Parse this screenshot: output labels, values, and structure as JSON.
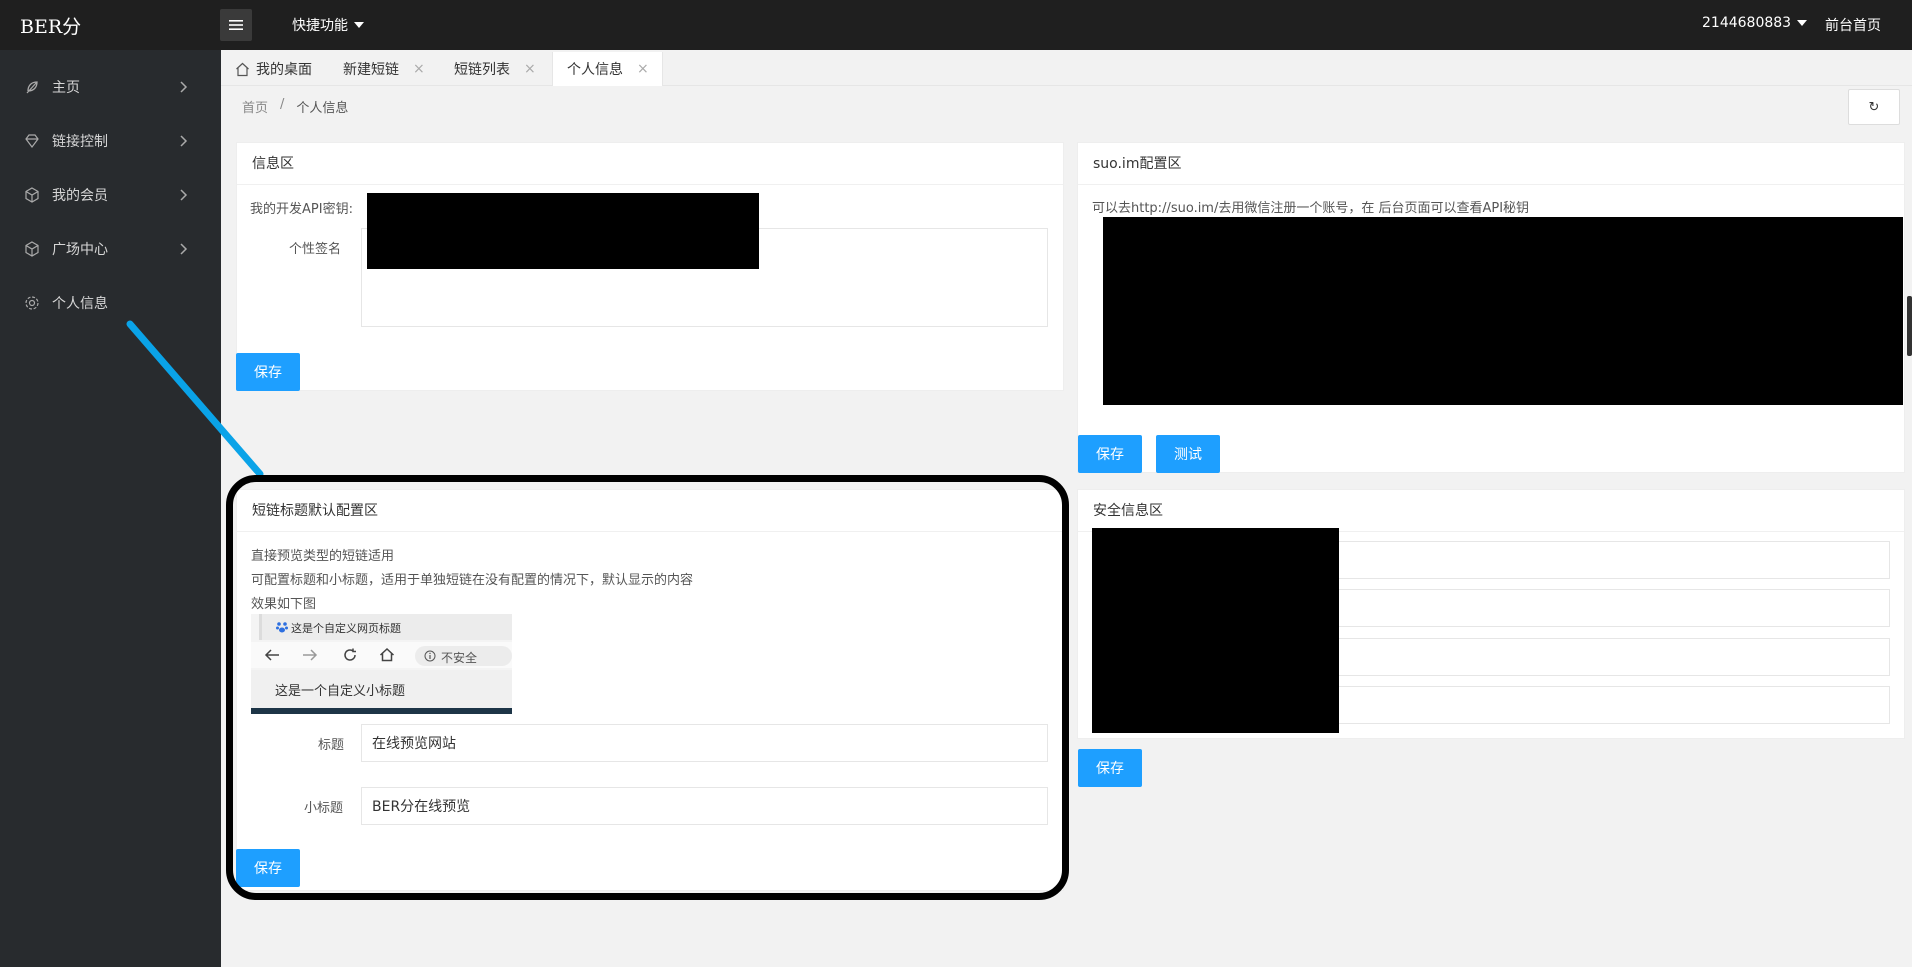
{
  "header": {
    "logo": "BER分",
    "quick_menu": "快捷功能",
    "user": "2144680883",
    "front_link": "前台首页"
  },
  "sidebar": {
    "items": [
      {
        "label": "主页",
        "icon": "leaf-icon"
      },
      {
        "label": "链接控制",
        "icon": "diamond-icon"
      },
      {
        "label": "我的会员",
        "icon": "cube-icon"
      },
      {
        "label": "广场中心",
        "icon": "cube-icon"
      },
      {
        "label": "个人信息",
        "icon": "gear-icon"
      }
    ]
  },
  "tabs": [
    {
      "label": "我的桌面"
    },
    {
      "label": "新建短链"
    },
    {
      "label": "短链列表"
    },
    {
      "label": "个人信息"
    }
  ],
  "tab_close_glyph": "×",
  "breadcrumb": {
    "home": "首页",
    "separator": "/",
    "current": "个人信息"
  },
  "refresh_glyph": "↻",
  "info_card": {
    "title": "信息区",
    "api_key_label": "我的开发API密钥:",
    "signature_label": "个性签名",
    "save": "保存"
  },
  "suo_card": {
    "title": "suo.im配置区",
    "hint": "可以去http://suo.im/去用微信注册一个账号，在 后台页面可以查看API秘钥",
    "save": "保存",
    "test": "测试"
  },
  "title_card": {
    "title": "短链标题默认配置区",
    "lines": [
      "直接预览类型的短链适用",
      "可配置标题和小标题，适用于单独短链在没有配置的情况下，默认显示的内容",
      "效果如下图"
    ],
    "preview": {
      "tab_title": "这是个自定义网页标题",
      "insecure": "不安全",
      "subtitle": "这是一个自定义小标题"
    },
    "title_label": "标题",
    "title_value": "在线预览网站",
    "subtitle_label": "小标题",
    "subtitle_value": "BER分在线预览",
    "save": "保存"
  },
  "security_card": {
    "title": "安全信息区",
    "save": "保存"
  },
  "colors": {
    "primary": "#1e9fff",
    "topbar": "#1f1f1f",
    "sidebar": "#282b2e",
    "annotation_arrow": "#0aa3e8"
  }
}
